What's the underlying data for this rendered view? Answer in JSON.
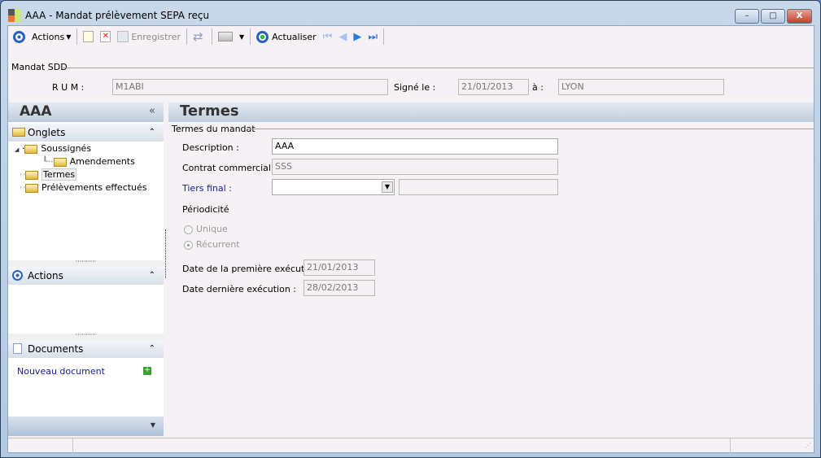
{
  "window": {
    "title": "AAA -  Mandat prélèvement SEPA reçu",
    "minimize": "–",
    "maximize": "□",
    "close": "X"
  },
  "toolbar": {
    "actions": "Actions",
    "save": "Enregistrer",
    "refresh": "Actualiser"
  },
  "mandat": {
    "group": "Mandat SDD",
    "rum_label": "R U M :",
    "rum": "M1ABI",
    "signed_label": "Signé le :",
    "signed": "21/01/2013",
    "at_label": "à :",
    "at": "LYON"
  },
  "left": {
    "title": "AAA",
    "collapse": "«",
    "onglets": "Onglets",
    "tree": [
      "Soussignés",
      "Amendements",
      "Termes",
      "Prélèvements effectués"
    ],
    "actions": "Actions",
    "documents": "Documents",
    "new_doc": "Nouveau document"
  },
  "right": {
    "title": "Termes",
    "group": "Termes du mandat",
    "description_label": "Description :",
    "description": "AAA",
    "contrat_label": "Contrat commercial :",
    "contrat": "SSS",
    "tiers_label": "Tiers final :",
    "tiers": "",
    "periodicite": "Périodicité",
    "unique": "Unique",
    "recurrent": "Récurrent",
    "selected": "Récurrent",
    "first_label": "Date de la première exécution :",
    "first": "21/01/2013",
    "last_label": "Date dernière exécution :",
    "last": "28/02/2013"
  },
  "colors": {
    "link": "#1a1aa0",
    "header": "#c0cddd"
  }
}
